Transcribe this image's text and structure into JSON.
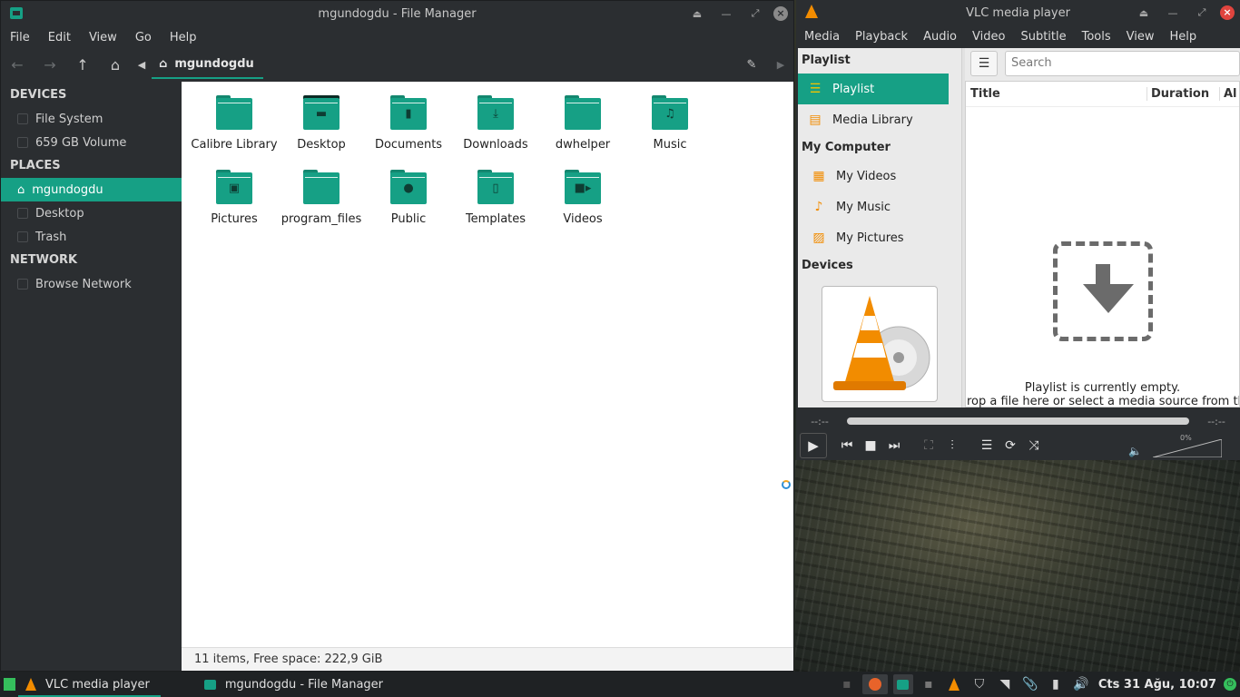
{
  "file_manager": {
    "title": "mgundogdu - File Manager",
    "menu": [
      "File",
      "Edit",
      "View",
      "Go",
      "Help"
    ],
    "path_button": "mgundogdu",
    "sidebar": {
      "devices_header": "DEVICES",
      "devices": [
        "File System",
        "659 GB Volume"
      ],
      "places_header": "PLACES",
      "places": [
        "mgundogdu",
        "Desktop",
        "Trash"
      ],
      "network_header": "NETWORK",
      "network": [
        "Browse Network"
      ]
    },
    "folders": [
      {
        "name": "Calibre Library",
        "icon": "folder-icon"
      },
      {
        "name": "Desktop",
        "icon": "desktop-folder-icon"
      },
      {
        "name": "Documents",
        "icon": "documents-folder-icon"
      },
      {
        "name": "Downloads",
        "icon": "downloads-folder-icon"
      },
      {
        "name": "dwhelper",
        "icon": "folder-icon"
      },
      {
        "name": "Music",
        "icon": "music-folder-icon"
      },
      {
        "name": "Pictures",
        "icon": "pictures-folder-icon"
      },
      {
        "name": "program_files",
        "icon": "folder-icon"
      },
      {
        "name": "Public",
        "icon": "public-folder-icon"
      },
      {
        "name": "Templates",
        "icon": "templates-folder-icon"
      },
      {
        "name": "Videos",
        "icon": "videos-folder-icon"
      }
    ],
    "status": "11 items, Free space: 222,9 GiB"
  },
  "vlc": {
    "title": "VLC media player",
    "menu": [
      "Media",
      "Playback",
      "Audio",
      "Video",
      "Subtitle",
      "Tools",
      "View",
      "Help"
    ],
    "side": {
      "playlist_header": "Playlist",
      "playlist_items": [
        "Playlist",
        "Media Library"
      ],
      "computer_header": "My Computer",
      "computer_items": [
        "My Videos",
        "My Music",
        "My Pictures"
      ],
      "devices_header": "Devices"
    },
    "search_placeholder": "Search",
    "columns": [
      "Title",
      "Duration",
      "Al"
    ],
    "empty_line1": "Playlist is currently empty.",
    "empty_line2": "rop a file here or select a media source from the le",
    "time_elapsed": "--:--",
    "time_total": "--:--",
    "volume": "0%"
  },
  "taskbar": {
    "tasks": [
      "VLC media player",
      "mgundogdu - File Manager"
    ],
    "clock": "Cts 31 Ağu, 10:07"
  },
  "colors": {
    "accent": "#16a085",
    "dark_bg": "#2b2e31",
    "vlc_orange": "#f28c00"
  }
}
